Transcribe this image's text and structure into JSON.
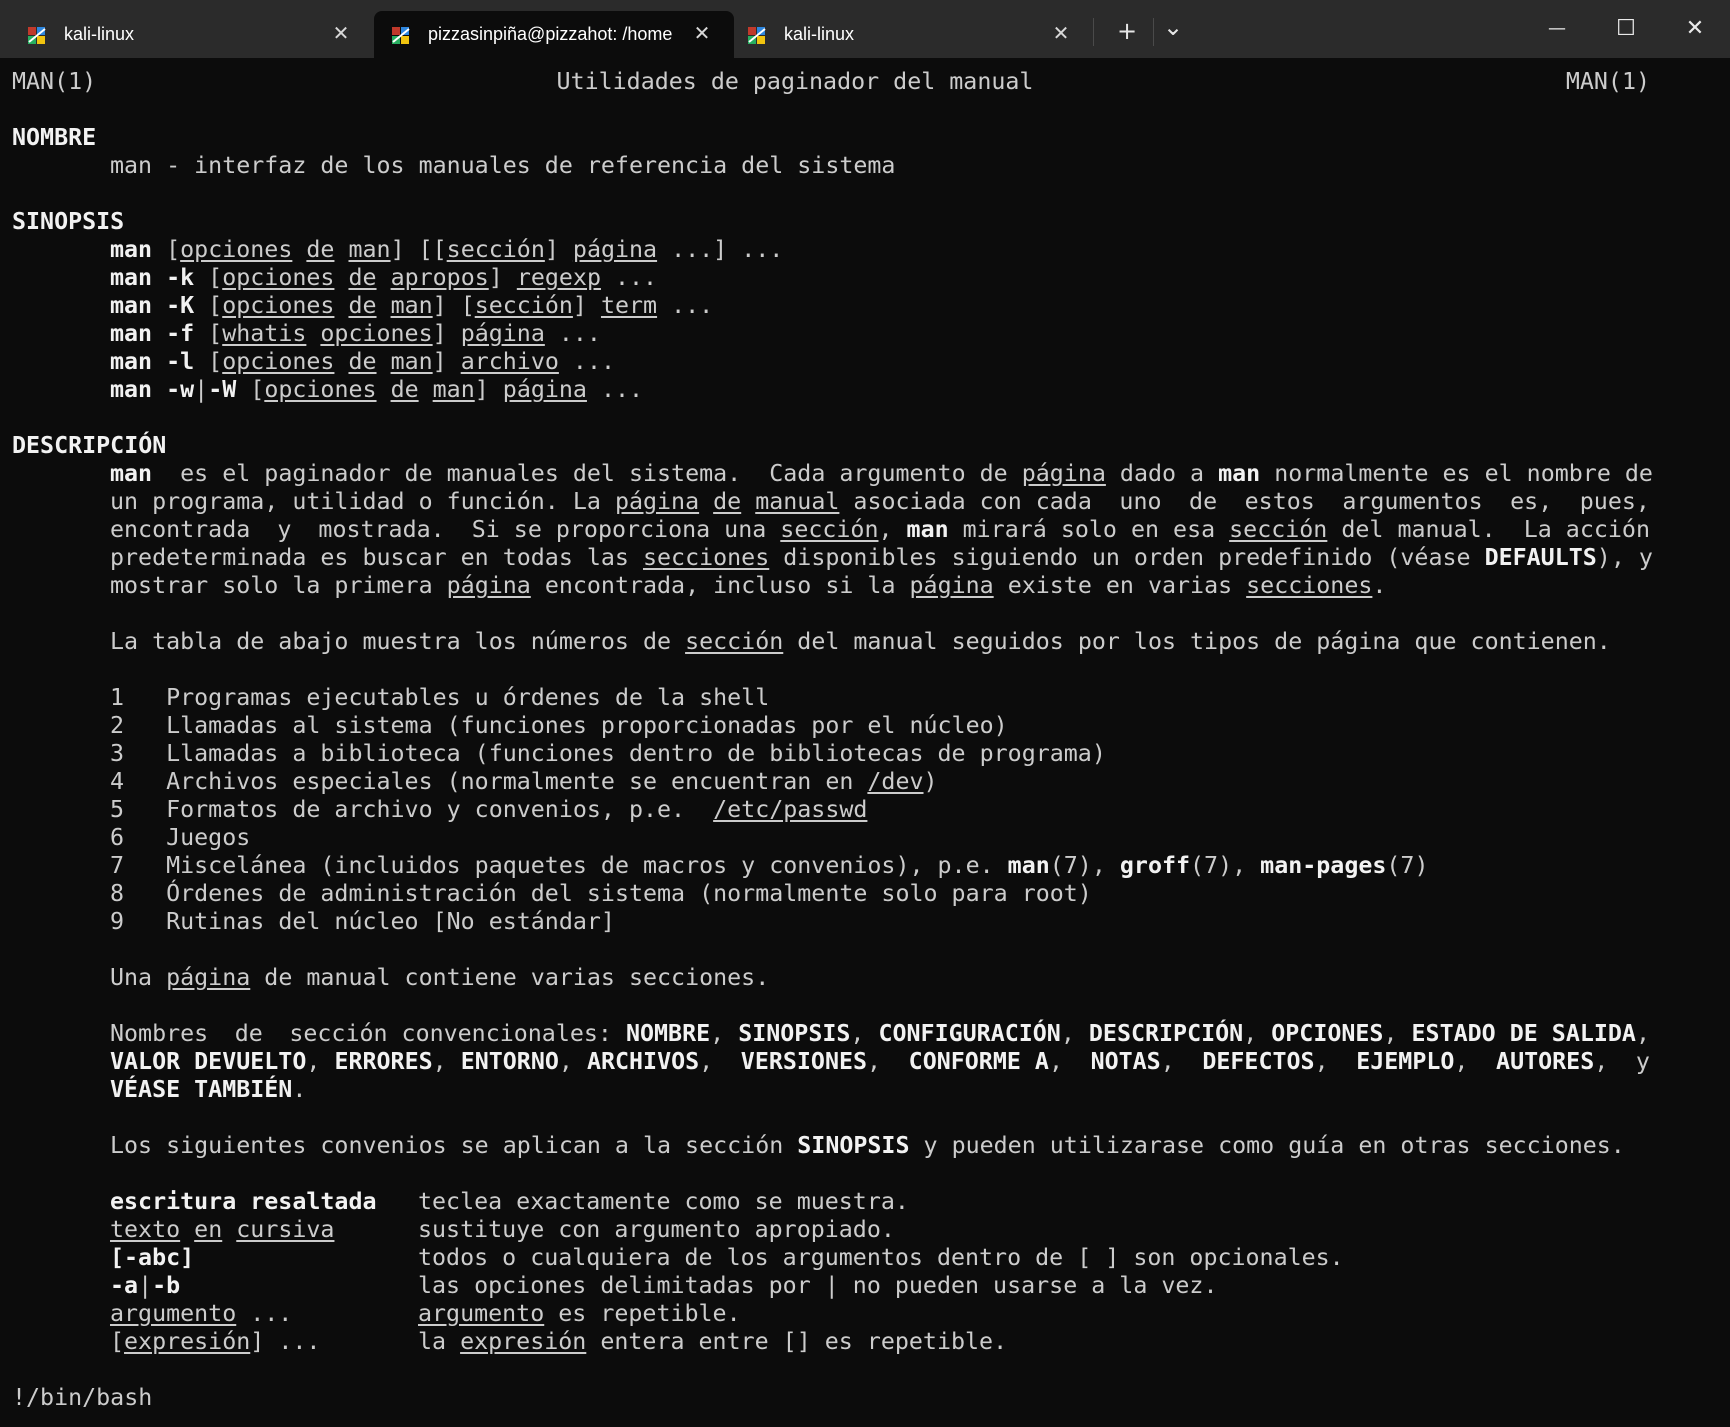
{
  "tabs": [
    {
      "label": "kali-linux",
      "active": false
    },
    {
      "label": "pizzasinpiña@pizzahot: /home",
      "active": true
    },
    {
      "label": "kali-linux",
      "active": false
    }
  ],
  "icons": {
    "tab": "kali-dragon-icon",
    "close": "close-icon",
    "new_tab": "plus-icon",
    "dropdown": "chevron-down-icon",
    "minimize": "minimize-icon",
    "maximize": "maximize-icon",
    "close_window": "close-icon"
  },
  "glyphs": {
    "close": "✕",
    "plus": "+",
    "chevron": "⌄",
    "minimize": "—",
    "maximize": "☐",
    "close_window": "✕"
  },
  "colors": {
    "terminal_bg": "#0c0c0c",
    "titlebar_bg": "#2b2b2b",
    "text": "#cccccc",
    "bold_text": "#f2f2f2"
  },
  "man": {
    "header_left": "MAN(1)",
    "header_center": "Utilidades de paginador del manual",
    "header_right": "MAN(1)",
    "nombre": {
      "heading": "NOMBRE",
      "text": "man - interfaz de los manuales de referencia del sistema"
    },
    "sinopsis": {
      "heading": "SINOPSIS",
      "l1": {
        "cmd": "man",
        "a": "[",
        "b": "opciones",
        "c": "de",
        "d": "man",
        "e": "] [[",
        "f": "sección",
        "g": "] ",
        "h": "página",
        "i": " ...] ..."
      },
      "l2": {
        "cmd": "man -k",
        "a": " [",
        "b": "opciones",
        "c": "de",
        "d": "apropos",
        "e": "] ",
        "f": "regexp",
        "g": " ..."
      },
      "l3": {
        "cmd": "man -K",
        "a": " [",
        "b": "opciones",
        "c": "de",
        "d": "man",
        "e": "] [",
        "f": "sección",
        "g": "] ",
        "h": "term",
        "i": " ..."
      },
      "l4": {
        "cmd": "man -f",
        "a": " [",
        "b": "whatis",
        "c": "opciones",
        "d": "] ",
        "e": "página",
        "f": " ..."
      },
      "l5": {
        "cmd": "man -l",
        "a": " [",
        "b": "opciones",
        "c": "de",
        "d": "man",
        "e": "] ",
        "f": "archivo",
        "g": " ..."
      },
      "l6": {
        "cmd": "man -w",
        "sep": "|",
        "cmd2": "-W",
        "a": " [",
        "b": "opciones",
        "c": "de",
        "d": "man",
        "e": "] ",
        "f": "página",
        "g": " ..."
      }
    },
    "descripcion": {
      "heading": "DESCRIPCIÓN",
      "p1": {
        "l1": [
          "man",
          "es el paginador de manuales del sistema.",
          "Cada argumento de",
          "página",
          "dado a",
          "man",
          "normalmente es el nombre de"
        ],
        "l2": [
          "un programa, utilidad o función. La",
          "página",
          "de",
          "manual",
          "asociada con cada",
          "uno",
          "de",
          "estos",
          "argumentos",
          "es,",
          "pues,"
        ],
        "l3": [
          "encontrada",
          "y",
          "mostrada.",
          "Si se proporciona una",
          "sección",
          ",",
          "man",
          "mirará solo en esa",
          "sección",
          "del manual.",
          "La acción"
        ],
        "l4": [
          "predeterminada es buscar en todas las",
          "secciones",
          "disponibles siguiendo un orden predefinido (véase",
          "DEFAULTS",
          "), y"
        ],
        "l5": [
          "mostrar solo la primera",
          "página",
          "encontrada, incluso si la",
          "página",
          "existe en varias",
          "secciones",
          "."
        ]
      },
      "p2": [
        "La tabla de abajo muestra los números de",
        "sección",
        "del manual seguidos por los tipos de página que contienen."
      ],
      "table": [
        {
          "num": "1",
          "text": "Programas ejecutables u órdenes de la shell"
        },
        {
          "num": "2",
          "text": "Llamadas al sistema (funciones proporcionadas por el núcleo)"
        },
        {
          "num": "3",
          "text": "Llamadas a biblioteca (funciones dentro de bibliotecas de programa)"
        },
        {
          "num": "4",
          "text": "Archivos especiales (normalmente se encuentran en ",
          "link": "/dev",
          "tail": ")"
        },
        {
          "num": "5",
          "text": "Formatos de archivo y convenios, p.e.  ",
          "link": "/etc/passwd",
          "tail": ""
        },
        {
          "num": "6",
          "text": "Juegos"
        },
        {
          "num": "7",
          "text": "Miscelánea (incluidos paquetes de macros y convenios), p.e. ",
          "b1": "man",
          "t1": "(7), ",
          "b2": "groff",
          "t2": "(7), ",
          "b3": "man-pages",
          "t3": "(7)"
        },
        {
          "num": "8",
          "text": "Órdenes de administración del sistema (normalmente solo para root)"
        },
        {
          "num": "9",
          "text": "Rutinas del núcleo [No estándar]"
        }
      ],
      "p3": [
        "Una",
        "página",
        "de manual contiene varias secciones."
      ],
      "p4": {
        "l1": [
          "Nombres",
          "de",
          "sección convencionales:",
          "NOMBRE",
          ",",
          "SINOPSIS",
          ",",
          "CONFIGURACIÓN",
          ",",
          "DESCRIPCIÓN",
          ",",
          "OPCIONES",
          ",",
          "ESTADO DE SALIDA",
          ","
        ],
        "l2": [
          "VALOR DEVUELTO",
          ",",
          "ERRORES",
          ",",
          "ENTORNO",
          ",",
          "ARCHIVOS",
          ",",
          "VERSIONES",
          ",",
          "CONFORME A",
          ",",
          "NOTAS",
          ",",
          "DEFECTOS",
          ",",
          "EJEMPLO",
          ",",
          "AUTORES",
          ",",
          "y"
        ],
        "l3": [
          "VÉASE TAMBIÉN",
          "."
        ]
      },
      "p5": [
        "Los siguientes convenios se aplican a la sección",
        "SINOPSIS",
        "y pueden utilizarase como guía en otras secciones."
      ],
      "conventions": {
        "c1": {
          "term": "escritura resaltada",
          "desc": "teclea exactamente como se muestra."
        },
        "c2": {
          "t1": "texto",
          "t2": "en",
          "t3": "cursiva",
          "desc": "sustituye con argumento apropiado."
        },
        "c3": {
          "term": "[-abc]",
          "desc": "todos o cualquiera de los argumentos dentro de [ ] son opcionales."
        },
        "c4": {
          "term": "-a",
          "sep": "|",
          "term2": "-b",
          "desc": "las opciones delimitadas por | no pueden usarse a la vez."
        },
        "c5": {
          "t1": "argumento",
          "t2": " ...",
          "d1": "argumento",
          "d2": " es repetible."
        },
        "c6": {
          "t1": "[",
          "t2": "expresión",
          "t3": "] ...",
          "d1": "la ",
          "d2": "expresión",
          "d3": " entera entre [] es repetible."
        }
      }
    },
    "prompt": "!/bin/bash"
  }
}
